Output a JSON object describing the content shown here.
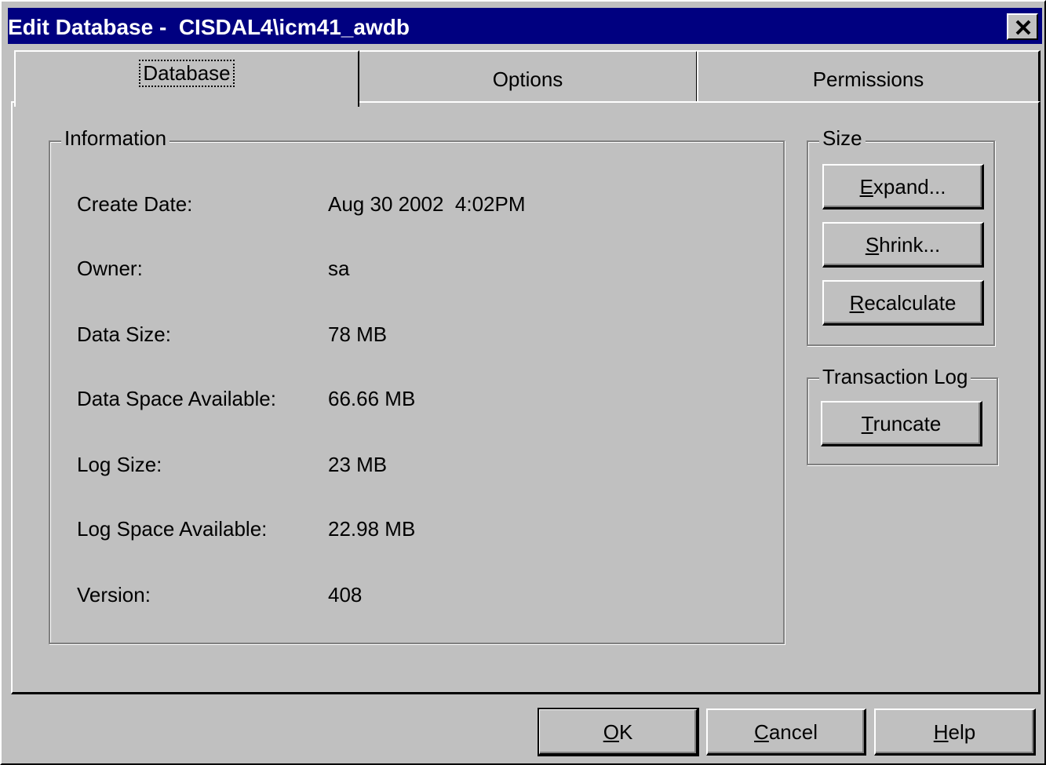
{
  "window": {
    "title": "Edit Database -  CISDAL4\\icm41_awdb",
    "close_glyph": "close-icon"
  },
  "tabs": [
    {
      "label": "Database",
      "active": true
    },
    {
      "label": "Options",
      "active": false
    },
    {
      "label": "Permissions",
      "active": false
    }
  ],
  "information": {
    "legend": "Information",
    "rows": [
      {
        "label": "Create Date:",
        "value": "Aug 30 2002  4:02PM"
      },
      {
        "label": "Owner:",
        "value": "sa"
      },
      {
        "label": "Data Size:",
        "value": "78 MB"
      },
      {
        "label": "Data Space Available:",
        "value": "66.66 MB"
      },
      {
        "label": "Log Size:",
        "value": "23 MB"
      },
      {
        "label": "Log Space Available:",
        "value": "22.98 MB"
      },
      {
        "label": "Version:",
        "value": "408"
      }
    ]
  },
  "size_group": {
    "legend": "Size",
    "expand": {
      "mnemonic": "E",
      "rest": "xpand..."
    },
    "shrink": {
      "mnemonic": "S",
      "rest": "hrink..."
    },
    "recalculate": {
      "mnemonic": "R",
      "rest": "ecalculate"
    }
  },
  "log_group": {
    "legend": "Transaction Log",
    "truncate": {
      "mnemonic": "T",
      "rest": "runcate"
    }
  },
  "footer": {
    "ok": {
      "mnemonic": "O",
      "rest": "K"
    },
    "cancel": {
      "mnemonic": "C",
      "rest": "ancel"
    },
    "help": {
      "mnemonic": "H",
      "rest": "elp"
    }
  }
}
